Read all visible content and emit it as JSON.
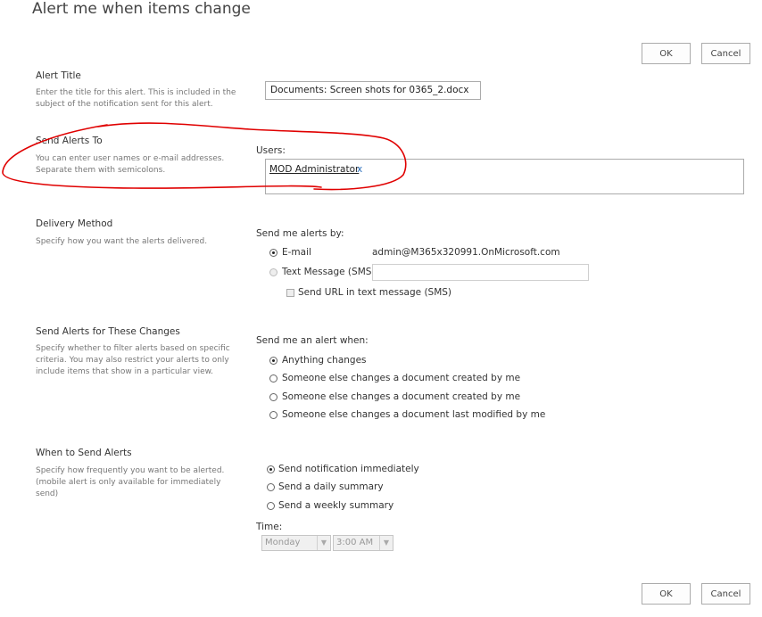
{
  "page": {
    "title": "Alert me when items change",
    "ok_label": "OK",
    "cancel_label": "Cancel"
  },
  "alert_title": {
    "heading": "Alert Title",
    "description": "Enter the title for this alert. This is included in the subject of the notification sent for this alert.",
    "value": "Documents: Screen shots for 0365_2.docx"
  },
  "send_alerts_to": {
    "heading": "Send Alerts To",
    "description": "You can enter user names or e-mail addresses. Separate them with semicolons.",
    "users_label": "Users:",
    "user": "MOD Administrator",
    "remove_glyph": "x"
  },
  "delivery": {
    "heading": "Delivery Method",
    "description": "Specify how you want the alerts delivered.",
    "prompt": "Send me alerts by:",
    "email_label": "E-mail",
    "email_address": "admin@M365x320991.OnMicrosoft.com",
    "sms_label": "Text Message (SMS)",
    "sms_value": "",
    "send_url_label": "Send URL in text message (SMS)",
    "selected": "email"
  },
  "changes": {
    "heading": "Send Alerts for These Changes",
    "description": "Specify whether to filter alerts based on specific criteria. You may also restrict your alerts to only include items that show in a particular view.",
    "prompt": "Send me an alert when:",
    "options": [
      "Anything changes",
      "Someone else changes a document created by me",
      "Someone else changes a document created by me",
      "Someone else changes a document last modified by me"
    ],
    "selected_index": 0
  },
  "when": {
    "heading": "When to Send Alerts",
    "description": "Specify how frequently you want to be alerted. (mobile alert is only available for immediately send)",
    "options": [
      "Send notification immediately",
      "Send a daily summary",
      "Send a weekly summary"
    ],
    "selected_index": 0,
    "time_label": "Time:",
    "day_value": "Monday",
    "time_value": "3:00 AM"
  },
  "colors": {
    "annotation": "#e00000",
    "link": "#2a6ebb"
  }
}
